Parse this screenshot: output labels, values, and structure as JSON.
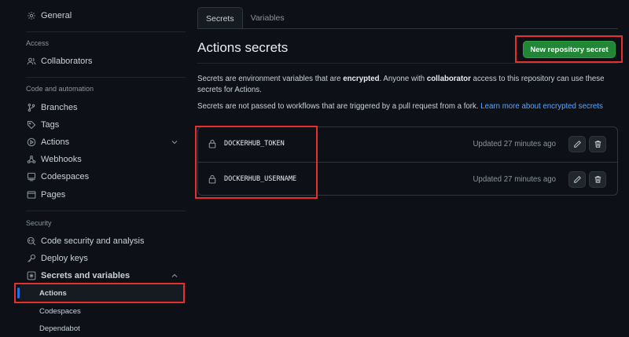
{
  "sidebar": {
    "general": "General",
    "sections": {
      "access": "Access",
      "code_automation": "Code and automation",
      "security": "Security"
    },
    "items": {
      "collaborators": "Collaborators",
      "branches": "Branches",
      "tags": "Tags",
      "actions": "Actions",
      "webhooks": "Webhooks",
      "codespaces": "Codespaces",
      "pages": "Pages",
      "code_security": "Code security and analysis",
      "deploy_keys": "Deploy keys",
      "secrets_variables": "Secrets and variables"
    },
    "sub_items": {
      "actions": "Actions",
      "codespaces": "Codespaces",
      "dependabot": "Dependabot"
    }
  },
  "tabs": [
    "Secrets",
    "Variables"
  ],
  "page_title": "Actions secrets",
  "new_secret_button": "New repository secret",
  "description": {
    "line1_a": "Secrets are environment variables that are ",
    "line1_b": "encrypted",
    "line1_c": ". Anyone with ",
    "line1_d": "collaborator",
    "line1_e": " access to this repository can use these secrets for Actions.",
    "line2": "Secrets are not passed to workflows that are triggered by a pull request from a fork. ",
    "link": "Learn more about encrypted secrets"
  },
  "secrets": [
    {
      "name": "DOCKERHUB_TOKEN",
      "updated": "Updated 27 minutes ago"
    },
    {
      "name": "DOCKERHUB_USERNAME",
      "updated": "Updated 27 minutes ago"
    }
  ],
  "colors": {
    "accent": "#1f6feb",
    "primary_button": "#238636",
    "highlight_box": "#e5302b",
    "link": "#58a6ff"
  }
}
